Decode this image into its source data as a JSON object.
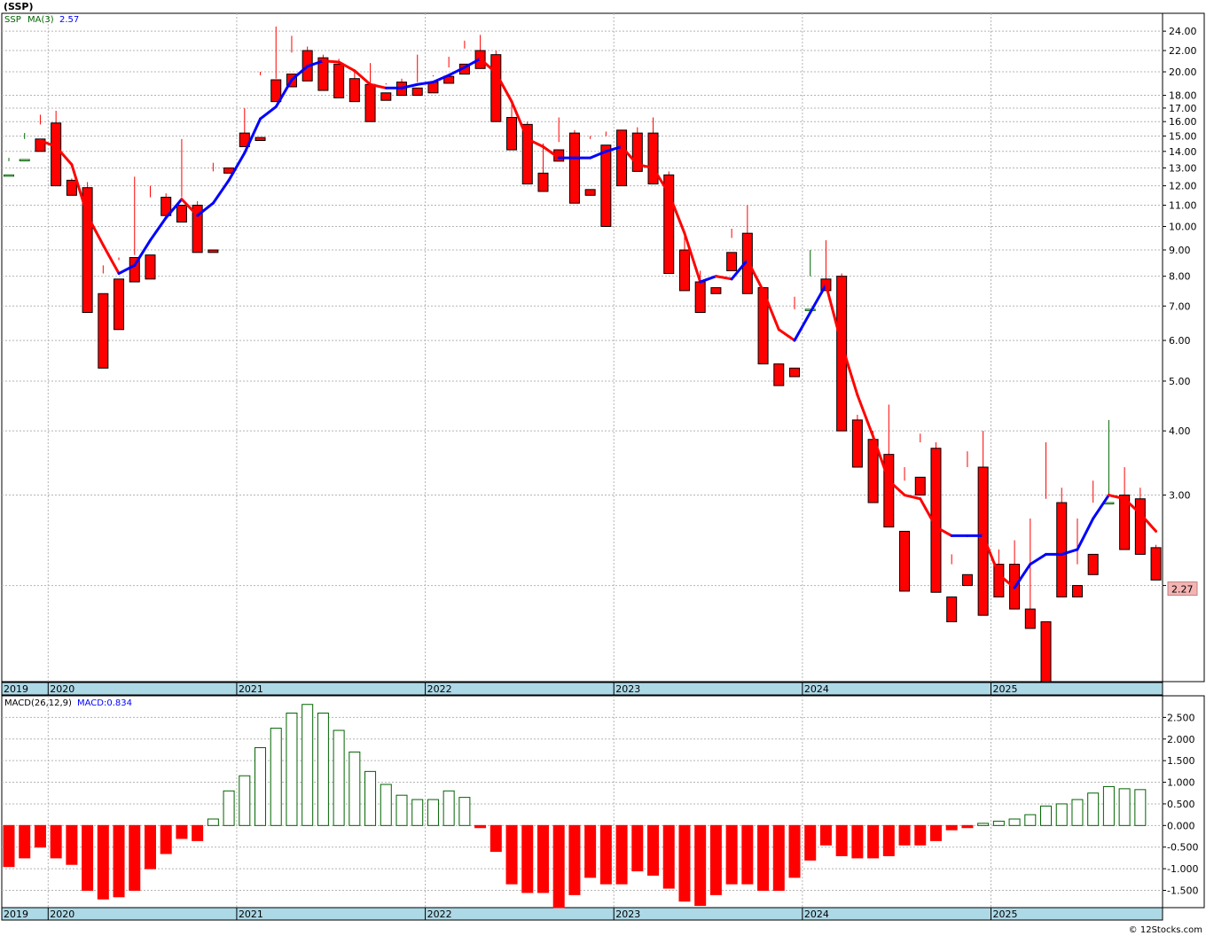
{
  "ticker": "(SSP)",
  "footer": "© 12Stocks.com",
  "colors": {
    "up": "#006400",
    "down": "#ff0000",
    "ma_up": "#0000ff",
    "ma_down": "#ff0000",
    "axis_band": "#add8e6",
    "grid": "#b4b4b4",
    "last_price_bg": "#f4b4b4"
  },
  "chart_data": [
    {
      "type": "candlestick",
      "title": "(SSP)",
      "scale": "log",
      "ylim": [
        1.3,
        26.0
      ],
      "legend": {
        "ticker": "SSP",
        "ma_label": "MA(3)",
        "ma_value": "2.57"
      },
      "last_price_label": "2.27",
      "y_ticks": [
        "24.00",
        "22.00",
        "20.00",
        "18.00",
        "17.00",
        "16.00",
        "15.00",
        "14.00",
        "13.00",
        "12.00",
        "11.00",
        "10.00",
        "9.00",
        "8.00",
        "7.00",
        "6.00",
        "5.00",
        "4.00",
        "3.00",
        "2.00"
      ],
      "x_labels": [
        {
          "month": 0,
          "label": "2019"
        },
        {
          "month": 3,
          "label": "2020"
        },
        {
          "month": 15,
          "label": "2021"
        },
        {
          "month": 27,
          "label": "2022"
        },
        {
          "month": 39,
          "label": "2023"
        },
        {
          "month": 51,
          "label": "2024"
        },
        {
          "month": 63,
          "label": "2025"
        }
      ],
      "first_month": "2019-10",
      "candles": [
        [
          12.6,
          13.6,
          13.4,
          12.6
        ],
        [
          13.5,
          15.2,
          14.8,
          13.5
        ],
        [
          14.8,
          16.5,
          15.8,
          14.0
        ],
        [
          15.9,
          16.8,
          12.1,
          12.0
        ],
        [
          12.3,
          12.4,
          11.9,
          11.5
        ],
        [
          11.9,
          12.2,
          7.5,
          6.8
        ],
        [
          7.4,
          8.4,
          8.1,
          5.3
        ],
        [
          7.9,
          8.6,
          8.7,
          6.3
        ],
        [
          8.7,
          12.5,
          8.8,
          7.8
        ],
        [
          8.8,
          12.0,
          11.4,
          7.9
        ],
        [
          11.4,
          11.6,
          11.0,
          10.5
        ],
        [
          11.0,
          14.8,
          11.4,
          10.2
        ],
        [
          11.0,
          11.2,
          9.0,
          8.9
        ],
        [
          9.0,
          13.3,
          12.8,
          8.9
        ],
        [
          13.0,
          15.3,
          15.3,
          12.7
        ],
        [
          15.2,
          17.0,
          14.8,
          14.3
        ],
        [
          14.9,
          20.0,
          19.7,
          14.7
        ],
        [
          19.3,
          24.5,
          19.4,
          17.5
        ],
        [
          19.8,
          23.5,
          21.8,
          18.7
        ],
        [
          22.0,
          22.4,
          21.3,
          19.2
        ],
        [
          21.3,
          21.6,
          20.5,
          18.4
        ],
        [
          20.7,
          21.2,
          19.2,
          17.8
        ],
        [
          19.4,
          20.0,
          18.7,
          17.5
        ],
        [
          18.9,
          20.8,
          18.2,
          16.0
        ],
        [
          18.2,
          19.0,
          18.9,
          17.6
        ],
        [
          19.1,
          19.4,
          18.6,
          18.0
        ],
        [
          18.6,
          21.6,
          19.1,
          18.0
        ],
        [
          19.1,
          19.7,
          19.6,
          18.2
        ],
        [
          19.6,
          21.4,
          20.4,
          19.0
        ],
        [
          20.7,
          23.0,
          22.2,
          19.8
        ],
        [
          22.0,
          23.6,
          20.9,
          20.3
        ],
        [
          21.6,
          22.0,
          16.4,
          16.0
        ],
        [
          16.3,
          17.6,
          15.5,
          14.1
        ],
        [
          15.8,
          16.0,
          12.2,
          12.1
        ],
        [
          12.7,
          14.5,
          12.6,
          11.7
        ],
        [
          14.1,
          16.3,
          14.6,
          13.4
        ],
        [
          15.2,
          15.4,
          11.2,
          11.1
        ],
        [
          11.8,
          15.0,
          14.8,
          11.5
        ],
        [
          14.4,
          15.3,
          15.0,
          10.0
        ],
        [
          15.4,
          15.4,
          13.2,
          12.0
        ],
        [
          15.2,
          15.6,
          13.4,
          12.8
        ],
        [
          15.2,
          16.3,
          12.5,
          12.1
        ],
        [
          12.6,
          12.8,
          8.7,
          8.1
        ],
        [
          9.0,
          9.6,
          7.7,
          7.5
        ],
        [
          7.8,
          8.2,
          7.2,
          6.8
        ],
        [
          7.6,
          9.1,
          9.1,
          7.4
        ],
        [
          8.9,
          9.9,
          9.5,
          8.2
        ],
        [
          9.7,
          11.0,
          7.5,
          7.4
        ],
        [
          7.6,
          7.6,
          5.5,
          5.4
        ],
        [
          5.4,
          5.4,
          5.4,
          4.9
        ],
        [
          5.3,
          7.3,
          6.9,
          5.1
        ],
        [
          6.9,
          9.0,
          8.0,
          6.9
        ],
        [
          7.9,
          9.4,
          7.9,
          7.5
        ],
        [
          8.0,
          8.1,
          4.1,
          4.0
        ],
        [
          4.2,
          4.3,
          4.0,
          3.4
        ],
        [
          3.85,
          4.0,
          3.7,
          2.9
        ],
        [
          3.6,
          4.5,
          2.6,
          2.6
        ],
        [
          2.55,
          3.4,
          3.2,
          1.95
        ],
        [
          3.25,
          3.95,
          3.8,
          3.0
        ],
        [
          3.7,
          3.8,
          1.95,
          1.94
        ],
        [
          1.9,
          2.3,
          2.2,
          1.7
        ],
        [
          2.1,
          3.65,
          3.4,
          2.0
        ],
        [
          3.4,
          4.0,
          2.0,
          1.75
        ],
        [
          2.2,
          2.35,
          1.95,
          1.9
        ],
        [
          2.2,
          2.45,
          1.85,
          1.8
        ],
        [
          1.8,
          2.7,
          1.7,
          1.65
        ],
        [
          1.7,
          3.8,
          2.95,
          1.3
        ],
        [
          2.9,
          3.1,
          2.2,
          1.9
        ],
        [
          2.0,
          2.7,
          2.2,
          1.9
        ],
        [
          2.3,
          3.2,
          2.9,
          2.1
        ],
        [
          2.9,
          4.2,
          3.0,
          2.9
        ],
        [
          3.0,
          3.4,
          2.95,
          2.35
        ],
        [
          2.95,
          3.1,
          2.35,
          2.3
        ],
        [
          2.37,
          2.4,
          2.2,
          2.05
        ]
      ],
      "ma3": [
        null,
        null,
        14.7,
        14.3,
        13.2,
        10.5,
        9.2,
        8.1,
        8.4,
        9.4,
        10.4,
        11.3,
        10.5,
        11.1,
        12.3,
        13.9,
        16.2,
        17.1,
        19.3,
        20.5,
        21.0,
        20.9,
        20.1,
        18.9,
        18.6,
        18.6,
        18.9,
        19.1,
        19.7,
        20.4,
        21.2,
        19.9,
        17.5,
        14.8,
        14.3,
        13.6,
        13.6,
        13.6,
        14.0,
        14.3,
        13.2,
        13.0,
        11.6,
        9.7,
        7.8,
        8.0,
        7.9,
        8.6,
        7.5,
        6.3,
        6.0,
        6.8,
        7.7,
        5.9,
        4.7,
        3.9,
        3.2,
        3.0,
        2.95,
        2.6,
        2.5,
        2.5,
        2.5,
        2.1,
        1.98,
        2.2,
        2.3,
        2.3,
        2.35,
        2.7,
        3.0,
        2.95,
        2.76,
        2.55
      ]
    },
    {
      "type": "bar",
      "title": "MACD(26,12,9)",
      "legend": {
        "label": "MACD(26,12,9)",
        "value_label": "MACD:0.834"
      },
      "ylim": [
        -1.9,
        3.0
      ],
      "y_ticks": [
        "2.500",
        "2.000",
        "1.500",
        "1.000",
        "0.500",
        "0.000",
        "-0.500",
        "-1.000",
        "-1.500"
      ],
      "y_tick_values": [
        2.5,
        2.0,
        1.5,
        1.0,
        0.5,
        0.0,
        -0.5,
        -1.0,
        -1.5
      ],
      "values": [
        -0.95,
        -0.75,
        -0.5,
        -0.75,
        -0.9,
        -1.5,
        -1.7,
        -1.65,
        -1.5,
        -1.0,
        -0.65,
        -0.3,
        -0.35,
        0.15,
        0.8,
        1.15,
        1.8,
        2.25,
        2.6,
        2.8,
        2.6,
        2.2,
        1.7,
        1.25,
        0.95,
        0.7,
        0.6,
        0.6,
        0.8,
        0.65,
        -0.05,
        -0.6,
        -1.35,
        -1.55,
        -1.55,
        -1.9,
        -1.6,
        -1.2,
        -1.35,
        -1.35,
        -1.05,
        -1.15,
        -1.45,
        -1.75,
        -1.85,
        -1.6,
        -1.35,
        -1.35,
        -1.5,
        -1.5,
        -1.2,
        -0.8,
        -0.45,
        -0.7,
        -0.75,
        -0.75,
        -0.7,
        -0.45,
        -0.45,
        -0.35,
        -0.1,
        -0.05,
        0.05,
        0.1,
        0.15,
        0.25,
        0.45,
        0.5,
        0.6,
        0.75,
        0.9,
        0.85,
        0.83
      ]
    }
  ]
}
